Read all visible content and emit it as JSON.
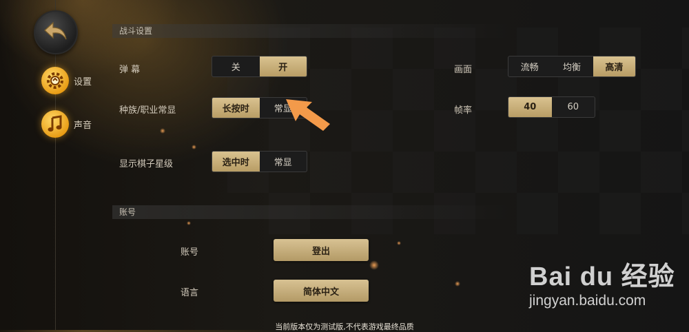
{
  "sidebar": {
    "back_icon": "back-arrow-icon",
    "items": [
      {
        "label": "设置",
        "icon": "gear-icon",
        "selected": true
      },
      {
        "label": "声音",
        "icon": "music-note-icon",
        "selected": false
      }
    ]
  },
  "battle": {
    "section_title": "战斗设置",
    "danmaku": {
      "label": "弹 幕",
      "options": [
        "关",
        "开"
      ],
      "selected": "开"
    },
    "race_display": {
      "label": "种族/职业常显",
      "options": [
        "长按时",
        "常显"
      ],
      "selected": "长按时"
    },
    "star_display": {
      "label": "显示棋子星级",
      "options": [
        "选中时",
        "常显"
      ],
      "selected": "选中时"
    },
    "quality": {
      "label": "画面",
      "options": [
        "流畅",
        "均衡",
        "高清"
      ],
      "selected": "高清"
    },
    "framerate": {
      "label": "帧率",
      "options": [
        "40",
        "60"
      ],
      "selected": "40"
    }
  },
  "account": {
    "section_title": "账号",
    "account_label": "账号",
    "logout_label": "登出",
    "language_label": "语言",
    "language_value": "简体中文"
  },
  "footer": {
    "notice": "当前版本仅为测试版,不代表游戏最终品质"
  },
  "watermark": {
    "logo_text": "Bai du 经验",
    "url": "jingyan.baidu.com"
  },
  "colors": {
    "accent_gold": "#c9b07a",
    "icon_orange": "#f0a41c",
    "pointer_arrow": "#f39a4a"
  }
}
